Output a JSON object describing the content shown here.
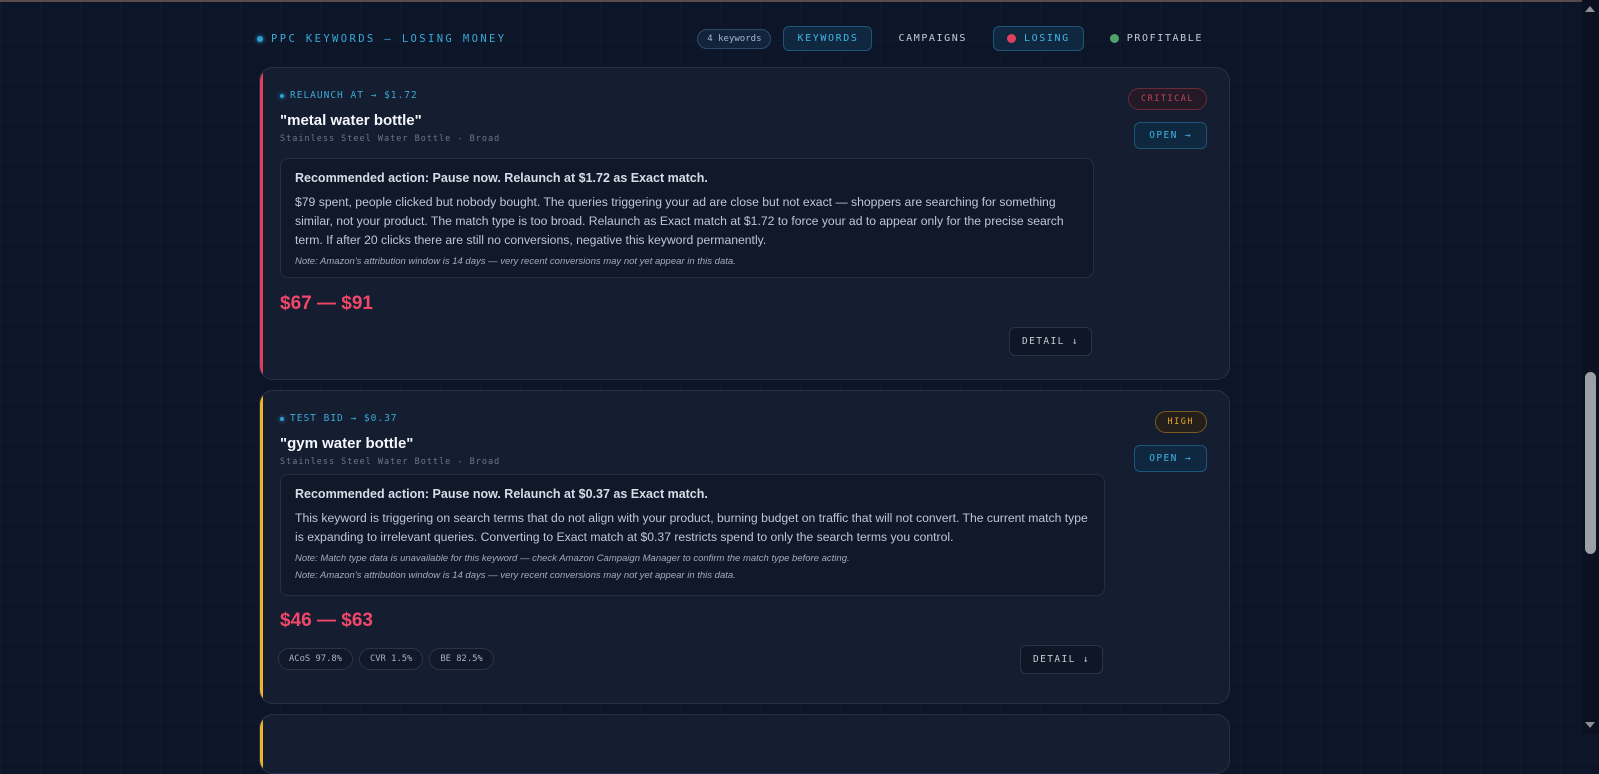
{
  "header": {
    "title": "PPC KEYWORDS — LOSING MONEY",
    "count": "4 keywords",
    "tabs": {
      "keywords": "KEYWORDS",
      "campaigns": "CAMPAIGNS",
      "losing": "LOSING",
      "profitable": "PROFITABLE"
    }
  },
  "colors": {
    "critical": "#e0405e",
    "high": "#f0b429",
    "accent": "#3fb5e6",
    "price": "#f0476a"
  },
  "cards": [
    {
      "recommendation_label": "RELAUNCH AT → $1.72",
      "keyword": "\"metal water bottle\"",
      "campaign": "Stainless Steel Water Bottle - Broad",
      "severity": "CRITICAL",
      "open_label": "OPEN →",
      "action_title": "Recommended action: Pause now. Relaunch at $1.72 as Exact match.",
      "action_body": "$79 spent, people clicked but nobody bought. The queries triggering your ad are close but not exact — shoppers are searching for something similar, not your product. The match type is too broad. Relaunch as Exact match at $1.72 to force your ad to appear only for the precise search term. If after 20 clicks there are still no conversions, negative this keyword permanently.",
      "notes": [
        "Note: Amazon's attribution window is 14 days — very recent conversions may not yet appear in this data."
      ],
      "price_range": "$67 — $91",
      "detail_label": "DETAIL ↓"
    },
    {
      "recommendation_label": "TEST BID → $0.37",
      "keyword": "\"gym water bottle\"",
      "campaign": "Stainless Steel Water Bottle - Broad",
      "severity": "HIGH",
      "open_label": "OPEN →",
      "action_title": "Recommended action: Pause now. Relaunch at $0.37 as Exact match.",
      "action_body": "This keyword is triggering on search terms that do not align with your product, burning budget on traffic that will not convert. The current match type is expanding to irrelevant queries. Converting to Exact match at $0.37 restricts spend to only the search terms you control.",
      "notes": [
        "Note: Match type data is unavailable for this keyword — check Amazon Campaign Manager to confirm the match type before acting.",
        "Note: Amazon's attribution window is 14 days — very recent conversions may not yet appear in this data."
      ],
      "price_range": "$46 — $63",
      "metrics": [
        "ACoS 97.8%",
        "CVR 1.5%",
        "BE 82.5%"
      ],
      "detail_label": "DETAIL ↓"
    }
  ]
}
